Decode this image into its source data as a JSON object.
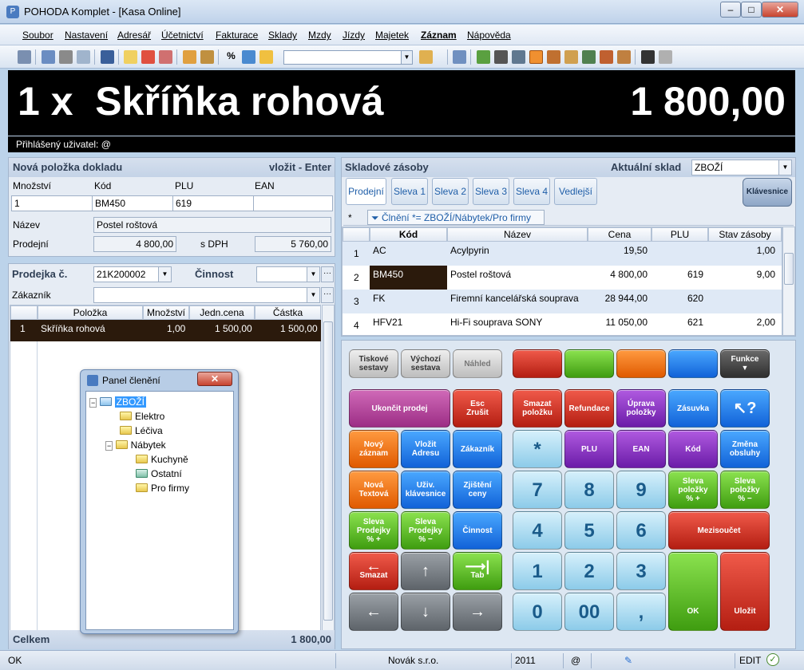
{
  "window": {
    "title": "POHODA Komplet - [Kasa Online]",
    "min": "–",
    "max": "□",
    "close": "✕"
  },
  "menu": [
    "Soubor",
    "Nastavení",
    "Adresář",
    "Účetnictví",
    "Fakturace",
    "Sklady",
    "Mzdy",
    "Jízdy",
    "Majetek",
    "Záznam",
    "Nápověda"
  ],
  "display": {
    "item": "1 x  Skříňka rohová",
    "price": "1 800,00",
    "user": "Přihlášený uživatel: @"
  },
  "newitem": {
    "header": "Nová položka dokladu",
    "action": "vložit - Enter",
    "lbl_qty": "Množství",
    "lbl_code": "Kód",
    "lbl_plu": "PLU",
    "lbl_ean": "EAN",
    "qty": "1",
    "code": "BM450",
    "plu": "619",
    "ean": "",
    "lbl_name": "Název",
    "name": "Postel roštová",
    "lbl_price": "Prodejní",
    "price": "4 800,00",
    "lbl_vat": "s DPH",
    "price_vat": "5 760,00"
  },
  "receipt": {
    "lbl_no": "Prodejka č.",
    "no": "21K200002",
    "lbl_activity": "Činnost",
    "lbl_customer": "Zákazník",
    "cols": [
      "Položka",
      "Množství",
      "Jedn.cena",
      "Částka"
    ],
    "rows": [
      {
        "n": "1",
        "item": "Skříňka rohová",
        "qty": "1,00",
        "unit": "1 500,00",
        "amount": "1 500,00"
      }
    ],
    "total_label": "Celkem",
    "total": "1 800,00"
  },
  "stock": {
    "header": "Skladové zásoby",
    "lbl_wh": "Aktuální sklad",
    "wh": "ZBOŽÍ",
    "tabs": [
      "Prodejní",
      "Sleva 1",
      "Sleva 2",
      "Sleva 3",
      "Sleva 4",
      "Vedlejší"
    ],
    "kb_button": "Klávesnice",
    "filter_star": "*",
    "filter": "Člnění *= ZBOŽÍ/Nábytek/Pro firmy",
    "cols": [
      "Kód",
      "Název",
      "Cena",
      "PLU",
      "Stav zásoby"
    ],
    "rows": [
      {
        "n": "1",
        "code": "AC",
        "name": "Acylpyrin",
        "price": "19,50",
        "plu": "",
        "stock": "1,00"
      },
      {
        "n": "2",
        "code": "BM450",
        "name": "Postel roštová",
        "price": "4 800,00",
        "plu": "619",
        "stock": "9,00"
      },
      {
        "n": "3",
        "code": "FK",
        "name": "Firemní kancelářská souprava",
        "price": "28 944,00",
        "plu": "620",
        "stock": ""
      },
      {
        "n": "4",
        "code": "HFV21",
        "name": "Hi-Fi souprava SONY",
        "price": "11 050,00",
        "plu": "621",
        "stock": "2,00"
      }
    ]
  },
  "keys": {
    "tiskove": "Tiskové\nsestavy",
    "vychozi": "Výchozí\nsestava",
    "nahled": "Náhled",
    "funkce": "Funkce",
    "ukoncit": "Ukončit prodej",
    "esc": "Esc\nZrušit",
    "smazat_pol": "Smazat\npoložku",
    "refundace": "Refundace",
    "uprava": "Úprava\npoložky",
    "zasuvka": "Zásuvka",
    "help": "↖?",
    "novy": "Nový\nzáznam",
    "vlozit_adr": "Vložit\nAdresu",
    "zakaznik": "Zákazník",
    "star": "*",
    "plu": "PLU",
    "ean": "EAN",
    "kod": "Kód",
    "zmena": "Změna\nobsluhy",
    "nova_text": "Nová\nTextová",
    "uziv": "Uživ.\nklávesnice",
    "zjisteni": "Zjištění\nceny",
    "sleva_pp": "Sleva\npoložky\n% +",
    "sleva_pm": "Sleva\npoložky\n% −",
    "sleva_dp": "Sleva\nProdejky\n% +",
    "sleva_dm": "Sleva\nProdejky\n% −",
    "cinnost": "Činnost",
    "mezisoucet": "Mezisoučet",
    "smazat": "Smazat",
    "tab": "Tab",
    "ok": "OK",
    "ulozit": "Uložit",
    "n0": "0",
    "n00": "00",
    "n1": "1",
    "n2": "2",
    "n3": "3",
    "n4": "4",
    "n5": "5",
    "n6": "6",
    "n7": "7",
    "n8": "8",
    "n9": "9",
    "comma": ",",
    "up": "↑",
    "down": "↓",
    "left": "←",
    "right": "→"
  },
  "tree": {
    "title": "Panel členění",
    "root": "ZBOŽÍ",
    "elektro": "Elektro",
    "leciva": "Léčiva",
    "nabytek": "Nábytek",
    "kuchyne": "Kuchyně",
    "ostatni": "Ostatní",
    "profirmy": "Pro firmy"
  },
  "status": {
    "left": "OK",
    "company": "Novák  s.r.o.",
    "year": "2011",
    "at": "@",
    "mode": "EDIT"
  }
}
